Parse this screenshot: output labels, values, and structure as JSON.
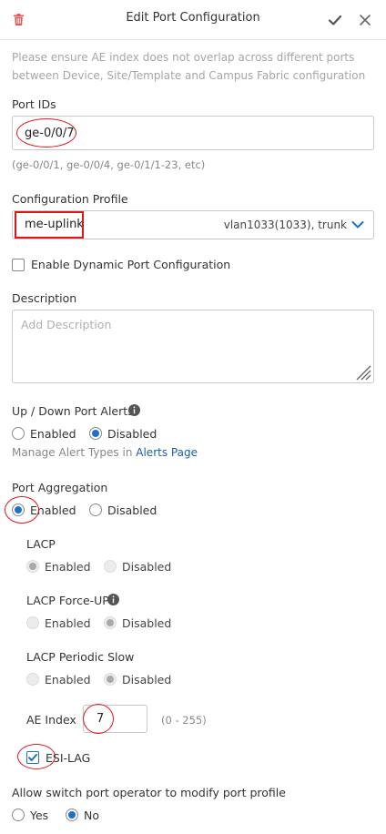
{
  "header": {
    "title": "Edit Port Configuration",
    "icons": [
      "trash-icon",
      "check-icon",
      "close-icon"
    ],
    "colors": {
      "trash": "#e05a5a",
      "check": "#555555",
      "close": "#666666"
    }
  },
  "note": "Please ensure AE index does not overlap across different ports between Device, Site/Template and Campus Fabric configuration",
  "port_ids": {
    "label": "Port IDs",
    "value": "ge-0/0/7",
    "hint": "(ge-0/0/1, ge-0/0/4, ge-0/1/1-23, etc)"
  },
  "config_profile": {
    "label": "Configuration Profile",
    "value": "me-uplink",
    "detail": "vlan1033(1033), trunk"
  },
  "dynamic_port": {
    "label": "Enable Dynamic Port Configuration",
    "checked": false
  },
  "description": {
    "label": "Description",
    "placeholder": "Add Description"
  },
  "alerts": {
    "label": "Up / Down Port Alerts",
    "enabled_label": "Enabled",
    "disabled_label": "Disabled",
    "selected": "Disabled",
    "manage_text": "Manage Alert Types in",
    "manage_link": "Alerts Page"
  },
  "port_aggregation": {
    "label": "Port Aggregation",
    "enabled_label": "Enabled",
    "disabled_label": "Disabled",
    "selected": "Enabled"
  },
  "lacp": {
    "label": "LACP",
    "enabled_label": "Enabled",
    "disabled_label": "Disabled",
    "selected": "Enabled"
  },
  "lacp_force_up": {
    "label": "LACP Force-UP",
    "enabled_label": "Enabled",
    "disabled_label": "Disabled",
    "selected": "Disabled"
  },
  "lacp_periodic_slow": {
    "label": "LACP Periodic Slow",
    "enabled_label": "Enabled",
    "disabled_label": "Disabled",
    "selected": "Disabled"
  },
  "ae_index": {
    "label": "AE Index",
    "value": "7",
    "range": "(0 - 255)"
  },
  "esi_lag": {
    "label": "ESI-LAG",
    "checked": true
  },
  "allow_modify": {
    "label": "Allow switch port operator to modify port profile",
    "yes_label": "Yes",
    "no_label": "No",
    "selected": "No"
  },
  "colors": {
    "accent": "#1a73c8",
    "annotation": "#e0141e",
    "link": "#1f5ea8"
  }
}
